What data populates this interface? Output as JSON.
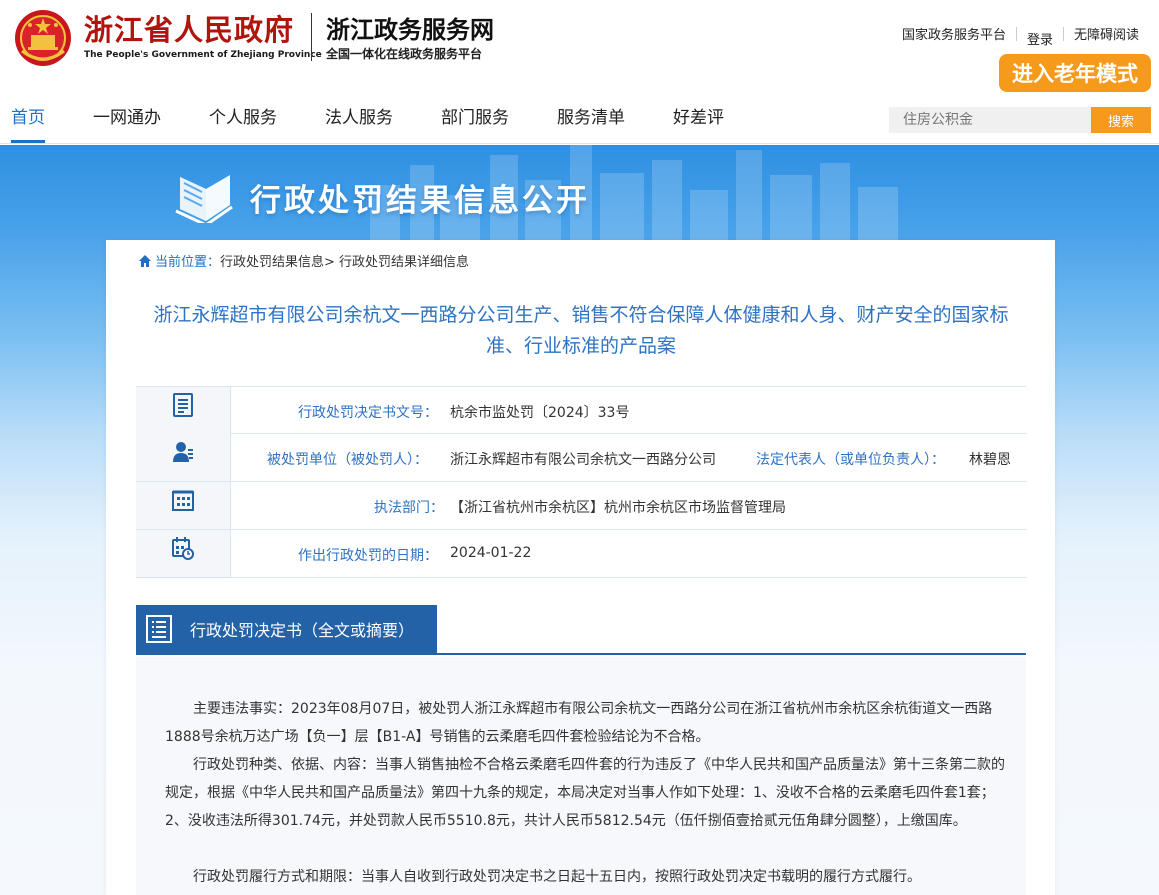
{
  "header": {
    "gov_name_cn": "浙江省人民政府",
    "gov_name_en": "The People's Government of Zhejiang Province",
    "site_name": "浙江政务服务网",
    "site_subtitle": "全国一体化在线政务服务平台",
    "links": [
      "国家政务服务平台",
      "登录",
      "无障碍阅读"
    ],
    "elder_mode": "进入老年模式"
  },
  "nav": {
    "items": [
      "首页",
      "一网通办",
      "个人服务",
      "法人服务",
      "部门服务",
      "服务清单",
      "好差评"
    ],
    "active_index": 0,
    "search_placeholder": "住房公积金",
    "search_button": "搜索"
  },
  "banner": {
    "title": "行政处罚结果信息公开"
  },
  "breadcrumb": {
    "current_label": "当前位置：",
    "path": "行政处罚结果信息> 行政处罚结果详细信息"
  },
  "case": {
    "title": "浙江永辉超市有限公司余杭文一西路分公司生产、销售不符合保障人体健康和人身、财产安全的国家标准、行业标准的产品案",
    "fields": {
      "decision_no_label": "行政处罚决定书文号：",
      "decision_no": "杭余市监处罚〔2024〕33号",
      "party_label": "被处罚单位（被处罚人）：",
      "party": "浙江永辉超市有限公司余杭文一西路分公司",
      "rep_label": "法定代表人（或单位负责人）：",
      "rep": "林碧恩",
      "dept_label": "执法部门：",
      "dept": "【浙江省杭州市余杭区】杭州市余杭区市场监督管理局",
      "date_label": "作出行政处罚的日期：",
      "date": "2024-01-22"
    }
  },
  "document": {
    "section_title": "行政处罚决定书（全文或摘要）",
    "paragraphs": [
      "主要违法事实：2023年08月07日，被处罚人浙江永辉超市有限公司余杭文一西路分公司在浙江省杭州市余杭区余杭街道文一西路1888号余杭万达广场【负一】层【B1-A】号销售的云柔磨毛四件套检验结论为不合格。",
      "行政处罚种类、依据、内容：当事人销售抽检不合格云柔磨毛四件套的行为违反了《中华人民共和国产品质量法》第十三条第二款的规定，根据《中华人民共和国产品质量法》第四十九条的规定，本局决定对当事人作如下处理：1、没收不合格的云柔磨毛四件套1套；2、没收违法所得301.74元，并处罚款人民币5510.8元，共计人民币5812.54元（伍仟捌佰壹拾贰元伍角肆分圆整），上缴国库。",
      "行政处罚履行方式和期限：当事人自收到行政处罚决定书之日起十五日内，按照行政处罚决定书载明的履行方式履行。"
    ]
  },
  "colors": {
    "brand_red": "#b0140c",
    "accent_orange": "#f59a1b",
    "link_blue": "#1f6fc5",
    "section_blue": "#2462a8"
  },
  "icons": [
    "national-emblem-icon",
    "book-icon",
    "home-icon",
    "document-icon",
    "person-icon",
    "building-icon",
    "calendar-icon",
    "list-document-icon"
  ]
}
